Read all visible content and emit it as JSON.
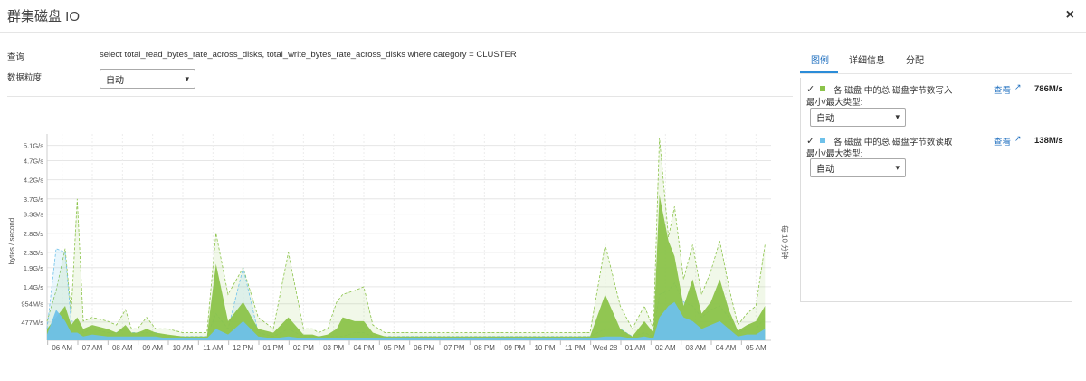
{
  "window": {
    "title": "群集磁盘 IO",
    "close": "×"
  },
  "form": {
    "query_label": "查询",
    "query_text": "select total_read_bytes_rate_across_disks, total_write_bytes_rate_across_disks where category = CLUSTER",
    "granularity_label": "数据粒度",
    "granularity_value": "自动"
  },
  "tabs": [
    "图例",
    "详细信息",
    "分配"
  ],
  "legend": [
    {
      "check": "✓",
      "name": "各 磁盘 中的总 磁盘字节数写入",
      "view": "查看",
      "value": "786M/s",
      "minmax_label": "最小/最大类型:",
      "minmax_value": "自动",
      "color": "#8bc34a"
    },
    {
      "check": "✓",
      "name": "各 磁盘 中的总 磁盘字节数读取",
      "view": "查看",
      "value": "138M/s",
      "minmax_label": "最小/最大类型:",
      "minmax_value": "自动",
      "color": "#6ec1ea"
    }
  ],
  "chart_data": {
    "type": "area",
    "ylabel": "bytes / second",
    "y2label": "每 10 分钟",
    "yticks": [
      "477M/s",
      "954M/s",
      "1.4G/s",
      "1.9G/s",
      "2.3G/s",
      "2.8G/s",
      "3.3G/s",
      "3.7G/s",
      "4.2G/s",
      "4.7G/s",
      "5.1G/s"
    ],
    "xticks": [
      "06 AM",
      "07 AM",
      "08 AM",
      "09 AM",
      "10 AM",
      "11 AM",
      "12 PM",
      "01 PM",
      "02 PM",
      "03 PM",
      "04 PM",
      "05 PM",
      "06 PM",
      "07 PM",
      "08 PM",
      "09 PM",
      "10 PM",
      "11 PM",
      "Wed 28",
      "01 AM",
      "02 AM",
      "03 AM",
      "04 AM",
      "05 AM"
    ],
    "ylim_gb": [
      0,
      5.4
    ],
    "x": [
      0,
      0.3,
      0.6,
      0.8,
      1.0,
      1.2,
      1.5,
      2.0,
      2.3,
      2.6,
      2.8,
      3.0,
      3.3,
      3.6,
      4.0,
      4.5,
      5.0,
      5.3,
      5.6,
      6.0,
      6.5,
      7.0,
      7.5,
      8.0,
      8.5,
      8.8,
      9.0,
      9.3,
      9.6,
      9.8,
      10.2,
      10.5,
      10.8,
      11.2,
      11.5,
      12.0,
      13.0,
      14.0,
      14.5,
      15.0,
      16.0,
      17.0,
      18.0,
      18.5,
      19.0,
      19.4,
      19.8,
      20.1,
      20.3,
      20.6,
      20.8,
      21.1,
      21.4,
      21.7,
      22.0,
      22.3,
      22.6,
      22.9,
      23.2,
      23.5,
      23.8
    ],
    "series": [
      {
        "name": "各 磁盘 中的总 磁盘字节数写入",
        "color": "#8bc34a",
        "max_gb": [
          0.5,
          1.3,
          2.4,
          0.7,
          3.7,
          0.5,
          0.6,
          0.5,
          0.4,
          0.8,
          0.3,
          0.3,
          0.6,
          0.3,
          0.3,
          0.2,
          0.2,
          0.2,
          2.8,
          1.2,
          1.9,
          0.6,
          0.3,
          2.3,
          0.3,
          0.3,
          0.2,
          0.3,
          1.0,
          1.2,
          1.3,
          1.4,
          0.4,
          0.2,
          0.2,
          0.2,
          0.2,
          0.2,
          0.2,
          0.2,
          0.2,
          0.2,
          0.2,
          2.5,
          0.9,
          0.3,
          0.9,
          0.3,
          5.3,
          2.7,
          3.5,
          1.6,
          2.5,
          1.2,
          1.8,
          2.6,
          1.4,
          0.4,
          0.7,
          0.9,
          2.5
        ],
        "values_gb": [
          0.3,
          0.6,
          0.9,
          0.4,
          0.6,
          0.3,
          0.4,
          0.3,
          0.2,
          0.4,
          0.2,
          0.2,
          0.3,
          0.2,
          0.15,
          0.1,
          0.1,
          0.1,
          2.0,
          0.5,
          1.0,
          0.3,
          0.2,
          0.6,
          0.15,
          0.15,
          0.1,
          0.15,
          0.3,
          0.6,
          0.5,
          0.5,
          0.2,
          0.1,
          0.1,
          0.1,
          0.1,
          0.1,
          0.1,
          0.1,
          0.1,
          0.1,
          0.1,
          1.2,
          0.3,
          0.1,
          0.5,
          0.2,
          3.8,
          2.6,
          2.2,
          0.9,
          1.6,
          0.7,
          1.0,
          1.6,
          0.8,
          0.25,
          0.4,
          0.5,
          0.9
        ]
      },
      {
        "name": "各 磁盘 中的总 磁盘字节数读取",
        "color": "#6ec1ea",
        "max_gb": [
          0.3,
          2.4,
          2.3,
          0.5,
          0.5,
          0.2,
          0.3,
          0.2,
          0.2,
          0.3,
          0.2,
          0.2,
          0.2,
          0.2,
          0.1,
          0.1,
          0.1,
          0.1,
          0.7,
          0.3,
          1.9,
          0.2,
          0.1,
          0.3,
          0.1,
          0.1,
          0.1,
          0.1,
          0.1,
          0.1,
          0.2,
          0.2,
          0.1,
          0.1,
          0.1,
          0.1,
          0.1,
          0.1,
          0.1,
          0.1,
          0.1,
          0.1,
          0.1,
          0.3,
          0.3,
          0.1,
          0.2,
          0.1,
          1.2,
          1.3,
          1.5,
          1.0,
          0.9,
          0.6,
          0.8,
          0.9,
          0.6,
          0.2,
          0.3,
          0.3,
          0.6
        ],
        "values_gb": [
          0.15,
          0.8,
          0.5,
          0.2,
          0.2,
          0.1,
          0.15,
          0.1,
          0.1,
          0.1,
          0.1,
          0.1,
          0.1,
          0.1,
          0.05,
          0.05,
          0.05,
          0.05,
          0.3,
          0.15,
          0.5,
          0.1,
          0.05,
          0.1,
          0.05,
          0.05,
          0.05,
          0.05,
          0.05,
          0.05,
          0.05,
          0.05,
          0.05,
          0.05,
          0.05,
          0.05,
          0.05,
          0.05,
          0.05,
          0.05,
          0.05,
          0.05,
          0.05,
          0.1,
          0.1,
          0.05,
          0.1,
          0.05,
          0.6,
          0.9,
          1.0,
          0.6,
          0.5,
          0.3,
          0.4,
          0.5,
          0.3,
          0.1,
          0.15,
          0.15,
          0.3
        ]
      }
    ],
    "grid": true,
    "legend": "right-panel"
  }
}
